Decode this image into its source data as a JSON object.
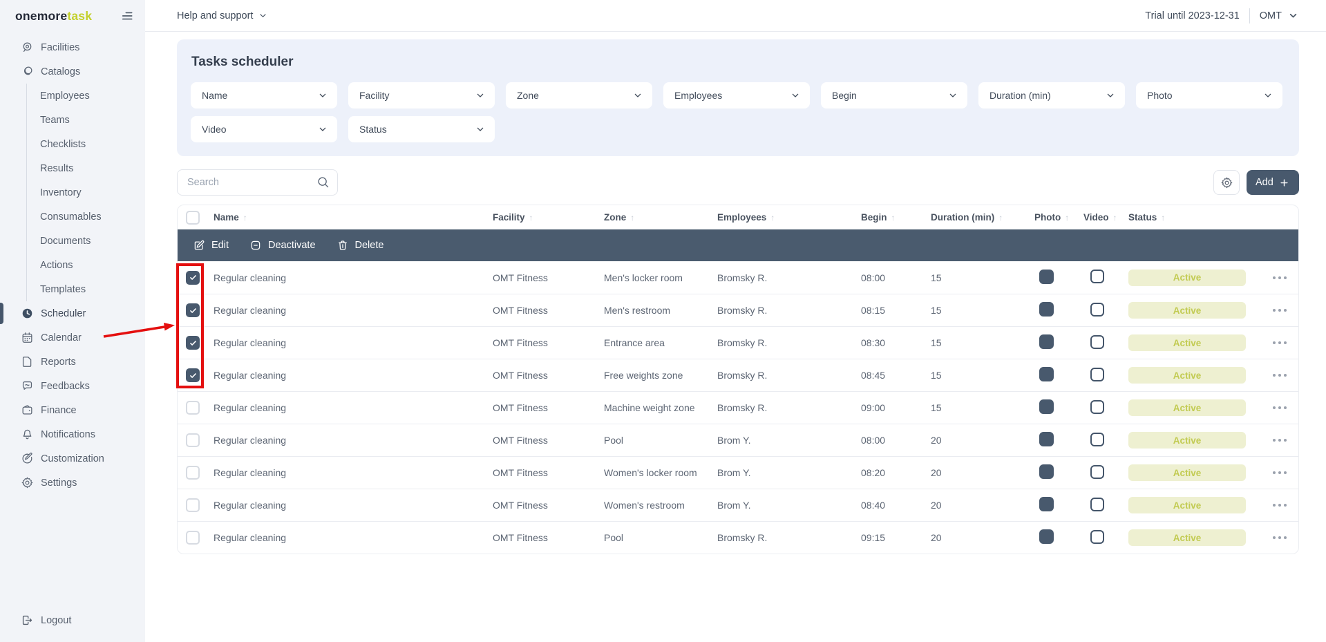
{
  "brand": {
    "primary": "onemore",
    "accent_text": "task"
  },
  "topbar": {
    "help": "Help and support",
    "trial": "Trial until 2023-12-31",
    "account": "OMT"
  },
  "sidebar": {
    "items": [
      {
        "label": "Facilities",
        "icon": "facilities-icon",
        "level": 0
      },
      {
        "label": "Catalogs",
        "icon": "catalogs-icon",
        "level": 0
      },
      {
        "label": "Employees",
        "level": 1
      },
      {
        "label": "Teams",
        "level": 1
      },
      {
        "label": "Checklists",
        "level": 1
      },
      {
        "label": "Results",
        "level": 1
      },
      {
        "label": "Inventory",
        "level": 1
      },
      {
        "label": "Consumables",
        "level": 1
      },
      {
        "label": "Documents",
        "level": 1
      },
      {
        "label": "Actions",
        "level": 1
      },
      {
        "label": "Templates",
        "level": 1
      },
      {
        "label": "Scheduler",
        "icon": "scheduler-icon",
        "level": 0,
        "active": true
      },
      {
        "label": "Calendar",
        "icon": "calendar-icon",
        "level": 0
      },
      {
        "label": "Reports",
        "icon": "reports-icon",
        "level": 0
      },
      {
        "label": "Feedbacks",
        "icon": "feedbacks-icon",
        "level": 0
      },
      {
        "label": "Finance",
        "icon": "finance-icon",
        "level": 0
      },
      {
        "label": "Notifications",
        "icon": "notifications-icon",
        "level": 0
      },
      {
        "label": "Customization",
        "icon": "customization-icon",
        "level": 0
      },
      {
        "label": "Settings",
        "icon": "settings-icon",
        "level": 0
      }
    ],
    "logout": "Logout"
  },
  "page": {
    "title": "Tasks scheduler"
  },
  "filters": {
    "row1": [
      "Name",
      "Facility",
      "Zone",
      "Employees",
      "Begin",
      "Duration (min)",
      "Photo"
    ],
    "row2": [
      "Video",
      "Status"
    ]
  },
  "toolbar": {
    "search_placeholder": "Search",
    "add_label": "Add"
  },
  "bulk_actions": {
    "edit": "Edit",
    "deactivate": "Deactivate",
    "delete": "Delete"
  },
  "table": {
    "columns": [
      {
        "label": "Name",
        "key": "name"
      },
      {
        "label": "Facility",
        "key": "facility"
      },
      {
        "label": "Zone",
        "key": "zone"
      },
      {
        "label": "Employees",
        "key": "employees"
      },
      {
        "label": "Begin",
        "key": "begin"
      },
      {
        "label": "Duration (min)",
        "key": "duration"
      },
      {
        "label": "Photo",
        "key": "photo"
      },
      {
        "label": "Video",
        "key": "video"
      },
      {
        "label": "Status",
        "key": "status"
      }
    ],
    "rows": [
      {
        "checked": true,
        "name": "Regular cleaning",
        "facility": "OMT Fitness",
        "zone": "Men's locker room",
        "employees": "Bromsky R.",
        "begin": "08:00",
        "duration": "15",
        "photo": true,
        "video": false,
        "status": "Active"
      },
      {
        "checked": true,
        "name": "Regular cleaning",
        "facility": "OMT Fitness",
        "zone": "Men's restroom",
        "employees": "Bromsky R.",
        "begin": "08:15",
        "duration": "15",
        "photo": true,
        "video": false,
        "status": "Active"
      },
      {
        "checked": true,
        "name": "Regular cleaning",
        "facility": "OMT Fitness",
        "zone": "Entrance area",
        "employees": "Bromsky R.",
        "begin": "08:30",
        "duration": "15",
        "photo": true,
        "video": false,
        "status": "Active"
      },
      {
        "checked": true,
        "name": "Regular cleaning",
        "facility": "OMT Fitness",
        "zone": "Free weights zone",
        "employees": "Bromsky R.",
        "begin": "08:45",
        "duration": "15",
        "photo": true,
        "video": false,
        "status": "Active"
      },
      {
        "checked": false,
        "name": "Regular cleaning",
        "facility": "OMT Fitness",
        "zone": "Machine weight zone",
        "employees": "Bromsky R.",
        "begin": "09:00",
        "duration": "15",
        "photo": true,
        "video": false,
        "status": "Active"
      },
      {
        "checked": false,
        "name": "Regular cleaning",
        "facility": "OMT Fitness",
        "zone": "Pool",
        "employees": "Brom Y.",
        "begin": "08:00",
        "duration": "20",
        "photo": true,
        "video": false,
        "status": "Active"
      },
      {
        "checked": false,
        "name": "Regular cleaning",
        "facility": "OMT Fitness",
        "zone": "Women's locker room",
        "employees": "Brom Y.",
        "begin": "08:20",
        "duration": "20",
        "photo": true,
        "video": false,
        "status": "Active"
      },
      {
        "checked": false,
        "name": "Regular cleaning",
        "facility": "OMT Fitness",
        "zone": "Women's restroom",
        "employees": "Brom Y.",
        "begin": "08:40",
        "duration": "20",
        "photo": true,
        "video": false,
        "status": "Active"
      },
      {
        "checked": false,
        "name": "Regular cleaning",
        "facility": "OMT Fitness",
        "zone": "Pool",
        "employees": "Bromsky R.",
        "begin": "09:15",
        "duration": "20",
        "photo": true,
        "video": false,
        "status": "Active"
      }
    ]
  },
  "colors": {
    "accent": "#c3d02c",
    "slate": "#48596d",
    "panel": "#edf1fa",
    "sidebar_bg": "#f2f4f8",
    "badge_bg": "#eef0d1",
    "badge_text": "#c2cb52",
    "annotation": "#e40f0f"
  }
}
